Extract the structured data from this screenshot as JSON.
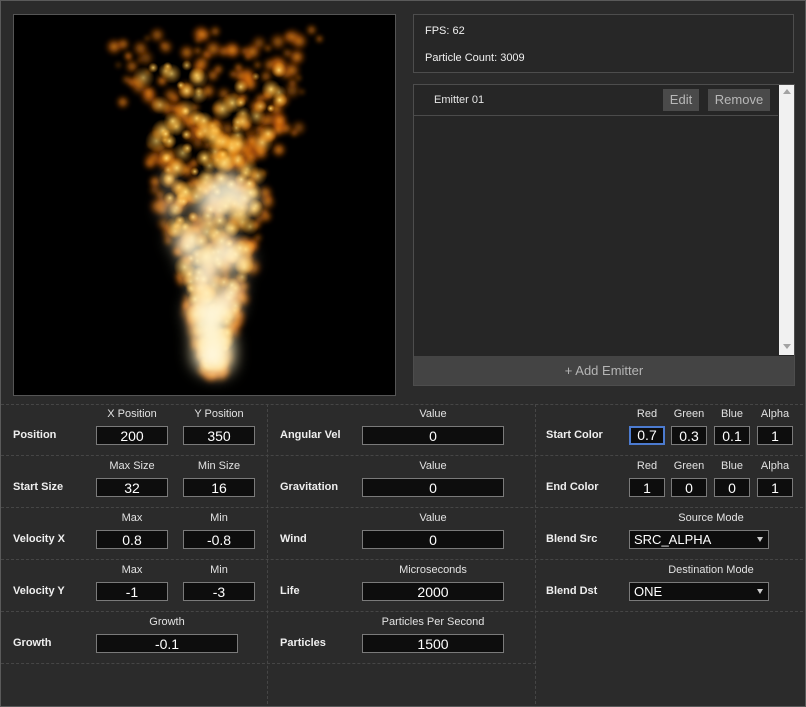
{
  "stats": {
    "fps": "FPS: 62",
    "particle_count": "Particle Count: 3009"
  },
  "emitters": {
    "items": [
      {
        "name": "Emitter 01",
        "edit_label": "Edit",
        "remove_label": "Remove"
      }
    ],
    "add_label": "+ Add Emitter"
  },
  "properties": {
    "position": {
      "label": "Position",
      "x_header": "X Position",
      "y_header": "Y Position",
      "x": "200",
      "y": "350"
    },
    "start_size": {
      "label": "Start Size",
      "max_header": "Max Size",
      "min_header": "Min Size",
      "max": "32",
      "min": "16"
    },
    "velocity_x": {
      "label": "Velocity X",
      "max_header": "Max",
      "min_header": "Min",
      "max": "0.8",
      "min": "-0.8"
    },
    "velocity_y": {
      "label": "Velocity Y",
      "max_header": "Max",
      "min_header": "Min",
      "max": "-1",
      "min": "-3"
    },
    "growth": {
      "label": "Growth",
      "header": "Growth",
      "value": "-0.1"
    },
    "angular_vel": {
      "label": "Angular Vel",
      "header": "Value",
      "value": "0"
    },
    "gravitation": {
      "label": "Gravitation",
      "header": "Value",
      "value": "0"
    },
    "wind": {
      "label": "Wind",
      "header": "Value",
      "value": "0"
    },
    "life": {
      "label": "Life",
      "header": "Microseconds",
      "value": "2000"
    },
    "particles": {
      "label": "Particles",
      "header": "Particles Per Second",
      "value": "1500"
    },
    "start_color": {
      "label": "Start Color",
      "headers": [
        "Red",
        "Green",
        "Blue",
        "Alpha"
      ],
      "values": [
        "0.7",
        "0.3",
        "0.1",
        "1"
      ]
    },
    "end_color": {
      "label": "End Color",
      "headers": [
        "Red",
        "Green",
        "Blue",
        "Alpha"
      ],
      "values": [
        "1",
        "0",
        "0",
        "1"
      ]
    },
    "blend_src": {
      "label": "Blend Src",
      "header": "Source Mode",
      "value": "SRC_ALPHA"
    },
    "blend_dst": {
      "label": "Blend Dst",
      "header": "Destination Mode",
      "value": "ONE"
    }
  },
  "colors": {
    "accent_focus": "#4c7bd0",
    "flame_core": "#fff8d8",
    "flame_mid": "#ffb020",
    "flame_outer": "#c04000"
  }
}
